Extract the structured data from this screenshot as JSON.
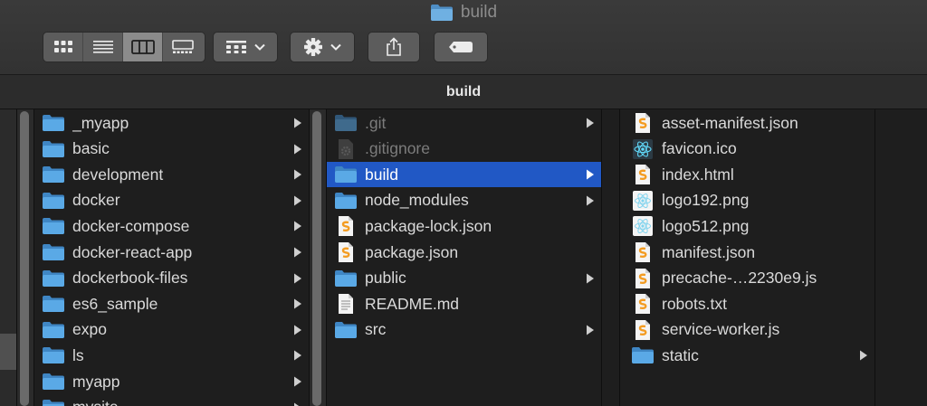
{
  "window": {
    "title": "build",
    "title_icon": "folder-icon"
  },
  "toolbar": {
    "view_modes": [
      {
        "name": "icon-view",
        "icon": "grid-icon",
        "selected": false
      },
      {
        "name": "list-view",
        "icon": "list-icon",
        "selected": false
      },
      {
        "name": "column-view",
        "icon": "columns-icon",
        "selected": true
      },
      {
        "name": "gallery-view",
        "icon": "gallery-icon",
        "selected": false
      }
    ],
    "group_icon": "group-icon",
    "action_icon": "gear-icon",
    "share_icon": "share-icon",
    "tags_icon": "tag-icon"
  },
  "pathbar": {
    "title": "build"
  },
  "colors": {
    "selection": "#2158c5",
    "folder": "#5aa9e6",
    "accent_swift": "#f39c22"
  },
  "columns": [
    {
      "items": [
        {
          "label": "_myapp",
          "type": "folder",
          "has_children": true
        },
        {
          "label": "basic",
          "type": "folder",
          "has_children": true
        },
        {
          "label": "development",
          "type": "folder",
          "has_children": true
        },
        {
          "label": "docker",
          "type": "folder",
          "has_children": true
        },
        {
          "label": "docker-compose",
          "type": "folder",
          "has_children": true
        },
        {
          "label": "docker-react-app",
          "type": "folder",
          "has_children": true
        },
        {
          "label": "dockerbook-files",
          "type": "folder",
          "has_children": true
        },
        {
          "label": "es6_sample",
          "type": "folder",
          "has_children": true
        },
        {
          "label": "expo",
          "type": "folder",
          "has_children": true
        },
        {
          "label": "ls",
          "type": "folder",
          "has_children": true
        },
        {
          "label": "myapp",
          "type": "folder",
          "has_children": true
        },
        {
          "label": "mysite",
          "type": "folder",
          "has_children": true
        }
      ]
    },
    {
      "items": [
        {
          "label": ".git",
          "type": "folder",
          "has_children": true,
          "dim": true
        },
        {
          "label": ".gitignore",
          "type": "gear-file",
          "has_children": false,
          "dim": true
        },
        {
          "label": "build",
          "type": "folder",
          "has_children": true,
          "selected": true
        },
        {
          "label": "node_modules",
          "type": "folder",
          "has_children": true
        },
        {
          "label": "package-lock.json",
          "type": "code-file",
          "has_children": false
        },
        {
          "label": "package.json",
          "type": "code-file",
          "has_children": false
        },
        {
          "label": "public",
          "type": "folder",
          "has_children": true
        },
        {
          "label": "README.md",
          "type": "text-file",
          "has_children": false
        },
        {
          "label": "src",
          "type": "folder",
          "has_children": true
        }
      ]
    },
    {
      "items": [
        {
          "label": "asset-manifest.json",
          "type": "code-file",
          "has_children": false
        },
        {
          "label": "favicon.ico",
          "type": "react-file",
          "has_children": false
        },
        {
          "label": "index.html",
          "type": "code-file",
          "has_children": false
        },
        {
          "label": "logo192.png",
          "type": "react-light-file",
          "has_children": false
        },
        {
          "label": "logo512.png",
          "type": "react-light-file",
          "has_children": false
        },
        {
          "label": "manifest.json",
          "type": "code-file",
          "has_children": false
        },
        {
          "label": "precache-…2230e9.js",
          "type": "code-file",
          "has_children": false
        },
        {
          "label": "robots.txt",
          "type": "code-file",
          "has_children": false
        },
        {
          "label": "service-worker.js",
          "type": "code-file",
          "has_children": false
        },
        {
          "label": "static",
          "type": "folder",
          "has_children": true
        }
      ]
    }
  ]
}
